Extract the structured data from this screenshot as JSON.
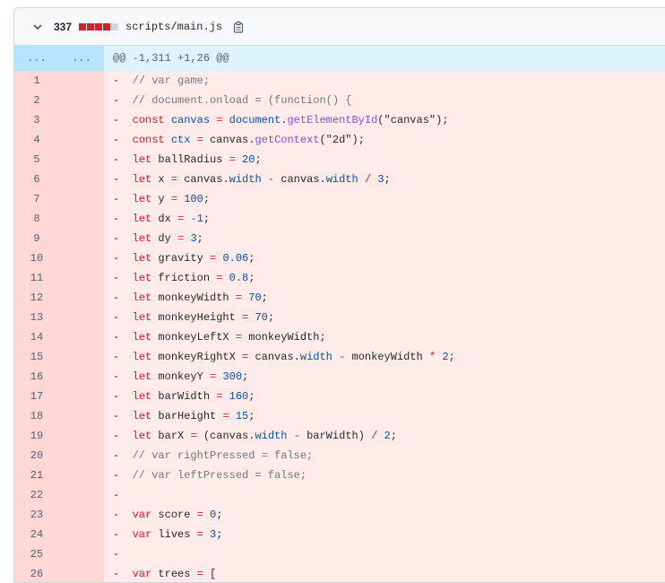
{
  "file": {
    "change_count": "337",
    "diffstat": {
      "deleted": 4,
      "neutral": 1
    },
    "filename": "scripts/main.js",
    "colors": {
      "deleted": "#cf222e",
      "neutral": "#d0d7de",
      "hunk_bg": "#ddf4ff",
      "del_line_bg": "#ffebe9",
      "del_num_bg": "#ffd7d5"
    }
  },
  "hunk": {
    "left": "...",
    "right": "...",
    "header": "@@ -1,311 +1,26 @@"
  },
  "lines": [
    {
      "n": "1",
      "code": [
        [
          "c",
          "// var game;"
        ]
      ]
    },
    {
      "n": "2",
      "code": [
        [
          "c",
          "// document.onload = (function() {"
        ]
      ]
    },
    {
      "n": "3",
      "code": [
        [
          "k",
          "const "
        ],
        [
          "v",
          "canvas"
        ],
        [
          "k",
          " = "
        ],
        [
          "v",
          "document"
        ],
        [
          "",
          "."
        ],
        [
          "f",
          "getElementById"
        ],
        [
          "",
          "(\"canvas\");"
        ]
      ]
    },
    {
      "n": "4",
      "code": [
        [
          "k",
          "const "
        ],
        [
          "v",
          "ctx"
        ],
        [
          "k",
          " = "
        ],
        [
          "",
          "canvas."
        ],
        [
          "f",
          "getContext"
        ],
        [
          "",
          "(\"2d\");"
        ]
      ]
    },
    {
      "n": "5",
      "code": [
        [
          "k",
          "let "
        ],
        [
          "",
          "ballRadius "
        ],
        [
          "k",
          "= "
        ],
        [
          "v",
          "20"
        ],
        [
          "",
          ";"
        ]
      ]
    },
    {
      "n": "6",
      "code": [
        [
          "k",
          "let "
        ],
        [
          "",
          "x "
        ],
        [
          "k",
          "= "
        ],
        [
          "",
          "canvas."
        ],
        [
          "v",
          "width"
        ],
        [
          "k",
          " - "
        ],
        [
          "",
          "canvas."
        ],
        [
          "v",
          "width"
        ],
        [
          "k",
          " / "
        ],
        [
          "v",
          "3"
        ],
        [
          "",
          ";"
        ]
      ]
    },
    {
      "n": "7",
      "code": [
        [
          "k",
          "let "
        ],
        [
          "",
          "y "
        ],
        [
          "k",
          "= "
        ],
        [
          "v",
          "100"
        ],
        [
          "",
          ";"
        ]
      ]
    },
    {
      "n": "8",
      "code": [
        [
          "k",
          "let "
        ],
        [
          "",
          "dx "
        ],
        [
          "k",
          "= "
        ],
        [
          "v",
          "-1"
        ],
        [
          "",
          ";"
        ]
      ]
    },
    {
      "n": "9",
      "code": [
        [
          "k",
          "let "
        ],
        [
          "",
          "dy "
        ],
        [
          "k",
          "= "
        ],
        [
          "v",
          "3"
        ],
        [
          "",
          ";"
        ]
      ]
    },
    {
      "n": "10",
      "code": [
        [
          "k",
          "let "
        ],
        [
          "",
          "gravity "
        ],
        [
          "k",
          "= "
        ],
        [
          "v",
          "0.06"
        ],
        [
          "",
          ";"
        ]
      ]
    },
    {
      "n": "11",
      "code": [
        [
          "k",
          "let "
        ],
        [
          "",
          "friction "
        ],
        [
          "k",
          "= "
        ],
        [
          "v",
          "0.8"
        ],
        [
          "",
          ";"
        ]
      ]
    },
    {
      "n": "12",
      "code": [
        [
          "k",
          "let "
        ],
        [
          "",
          "monkeyWidth "
        ],
        [
          "k",
          "= "
        ],
        [
          "v",
          "70"
        ],
        [
          "",
          ";"
        ]
      ]
    },
    {
      "n": "13",
      "code": [
        [
          "k",
          "let "
        ],
        [
          "",
          "monkeyHeight "
        ],
        [
          "k",
          "= "
        ],
        [
          "v",
          "70"
        ],
        [
          "",
          ";"
        ]
      ]
    },
    {
      "n": "14",
      "code": [
        [
          "k",
          "let "
        ],
        [
          "",
          "monkeyLeftX "
        ],
        [
          "k",
          "= "
        ],
        [
          "",
          "monkeyWidth;"
        ]
      ]
    },
    {
      "n": "15",
      "code": [
        [
          "k",
          "let "
        ],
        [
          "",
          "monkeyRightX "
        ],
        [
          "k",
          "= "
        ],
        [
          "",
          "canvas."
        ],
        [
          "v",
          "width"
        ],
        [
          "k",
          " - "
        ],
        [
          "",
          "monkeyWidth "
        ],
        [
          "k",
          "* "
        ],
        [
          "v",
          "2"
        ],
        [
          "",
          ";"
        ]
      ]
    },
    {
      "n": "16",
      "code": [
        [
          "k",
          "let "
        ],
        [
          "",
          "monkeyY "
        ],
        [
          "k",
          "= "
        ],
        [
          "v",
          "300"
        ],
        [
          "",
          ";"
        ]
      ]
    },
    {
      "n": "17",
      "code": [
        [
          "k",
          "let "
        ],
        [
          "",
          "barWidth "
        ],
        [
          "k",
          "= "
        ],
        [
          "v",
          "160"
        ],
        [
          "",
          ";"
        ]
      ]
    },
    {
      "n": "18",
      "code": [
        [
          "k",
          "let "
        ],
        [
          "",
          "barHeight "
        ],
        [
          "k",
          "= "
        ],
        [
          "v",
          "15"
        ],
        [
          "",
          ";"
        ]
      ]
    },
    {
      "n": "19",
      "code": [
        [
          "k",
          "let "
        ],
        [
          "",
          "barX "
        ],
        [
          "k",
          "= "
        ],
        [
          "",
          "(canvas."
        ],
        [
          "v",
          "width"
        ],
        [
          "k",
          " - "
        ],
        [
          "",
          "barWidth) "
        ],
        [
          "k",
          "/ "
        ],
        [
          "v",
          "2"
        ],
        [
          "",
          ";"
        ]
      ]
    },
    {
      "n": "20",
      "code": [
        [
          "c",
          "// var rightPressed = false;"
        ]
      ]
    },
    {
      "n": "21",
      "code": [
        [
          "c",
          "// var leftPressed = false;"
        ]
      ]
    },
    {
      "n": "22",
      "code": []
    },
    {
      "n": "23",
      "code": [
        [
          "k",
          "var "
        ],
        [
          "",
          "score "
        ],
        [
          "k",
          "= "
        ],
        [
          "v",
          "0"
        ],
        [
          "",
          ";"
        ]
      ]
    },
    {
      "n": "24",
      "code": [
        [
          "k",
          "var "
        ],
        [
          "",
          "lives "
        ],
        [
          "k",
          "= "
        ],
        [
          "v",
          "3"
        ],
        [
          "",
          ";"
        ]
      ]
    },
    {
      "n": "25",
      "code": []
    },
    {
      "n": "26",
      "code": [
        [
          "k",
          "var "
        ],
        [
          "",
          "trees "
        ],
        [
          "k",
          "= "
        ],
        [
          "",
          "["
        ]
      ]
    }
  ]
}
